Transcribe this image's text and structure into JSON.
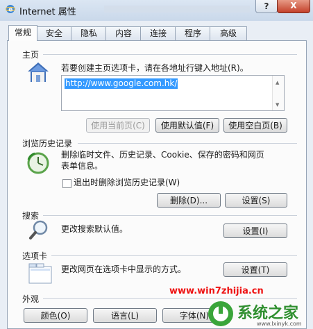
{
  "window": {
    "title": "Internet 属性",
    "help_glyph": "?",
    "close_glyph": "X"
  },
  "tabs": [
    "常规",
    "安全",
    "隐私",
    "内容",
    "连接",
    "程序",
    "高级"
  ],
  "active_tab": "常规",
  "home": {
    "section": "主页",
    "description": "若要创建主页选项卡，请在各地址行键入地址(R)。",
    "url": "http://www.google.com.hk/",
    "buttons": {
      "use_current": "使用当前页(C)",
      "use_default": "使用默认值(F)",
      "use_blank": "使用空白页(B)"
    }
  },
  "history": {
    "section": "浏览历史记录",
    "description_line1": "删除临时文件、历史记录、Cookie、保存的密码和网页",
    "description_line2": "表单信息。",
    "checkbox_label": "退出时删除浏览历史记录(W)",
    "delete_button": "删除(D)...",
    "settings_button": "设置(S)"
  },
  "search": {
    "section": "搜索",
    "description": "更改搜索默认值。",
    "settings_button": "设置(I)"
  },
  "tabs_section": {
    "section": "选项卡",
    "description": "更改网页在选项卡中显示的方式。",
    "settings_button": "设置(T)"
  },
  "appearance": {
    "section": "外观",
    "buttons": [
      "颜色(O)",
      "语言(L)",
      "字体(N)"
    ]
  },
  "watermark": {
    "site": "www.win7zhijia.cn",
    "logo_text": "系统之家",
    "logo_url": "www.lxinyk.com"
  }
}
